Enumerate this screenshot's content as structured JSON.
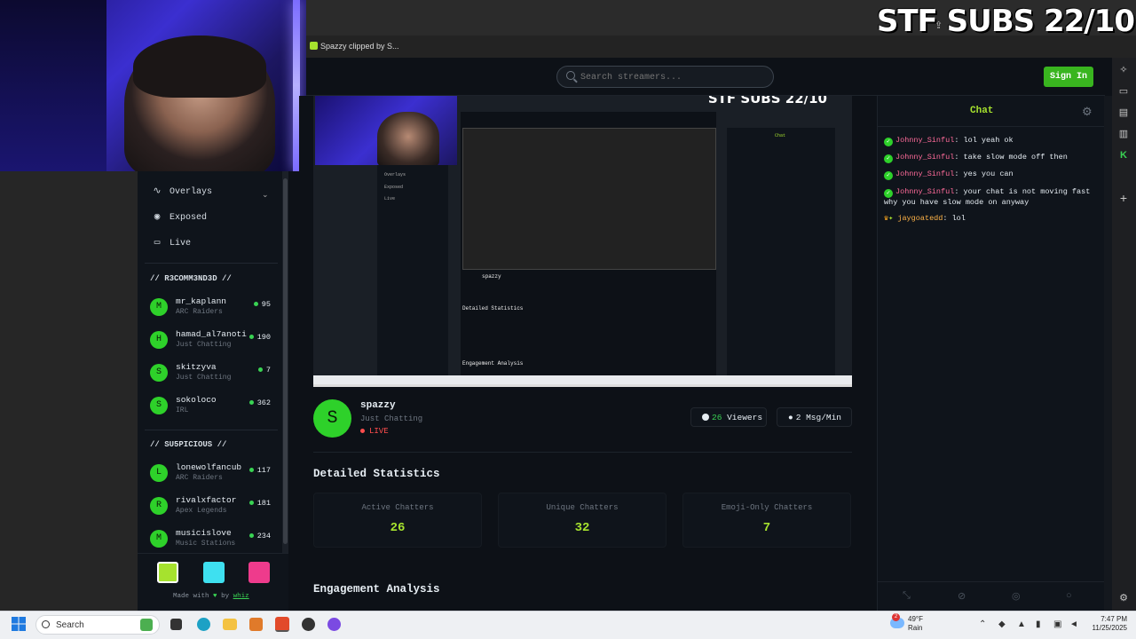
{
  "overlay": {
    "title": "STF SUBS 22/10"
  },
  "browser": {
    "tab_title": "Spazzy clipped by S...",
    "icons": [
      "share-icon",
      "sidebar-copilot-icon",
      "sidebar-tv-icon",
      "sidebar-calendar-icon",
      "sidebar-book-icon",
      "sidebar-kick-icon",
      "sidebar-add-icon",
      "sidebar-settings-icon"
    ]
  },
  "header": {
    "search_placeholder": "Search streamers...",
    "signin_label": "Sign In"
  },
  "sidebar": {
    "nav": [
      {
        "label": "Overlays",
        "icon": "activity-icon"
      },
      {
        "label": "Exposed",
        "icon": "eye-icon"
      },
      {
        "label": "Live",
        "icon": "tv-icon"
      }
    ],
    "sections": [
      {
        "title": "// R3COMM3ND3D //",
        "streamers": [
          {
            "initial": "M",
            "name": "mr_kaplann",
            "category": "ARC Raiders",
            "viewers": "95"
          },
          {
            "initial": "H",
            "name": "hamad_al7anoti",
            "category": "Just Chatting",
            "viewers": "190"
          },
          {
            "initial": "S",
            "name": "skitzyva",
            "category": "Just Chatting",
            "viewers": "7"
          },
          {
            "initial": "S",
            "name": "sokoloco",
            "category": "IRL",
            "viewers": "362"
          }
        ]
      },
      {
        "title": "// SU5PICIOUS //",
        "streamers": [
          {
            "initial": "L",
            "name": "lonewolfancub",
            "category": "ARC Raiders",
            "viewers": "117"
          },
          {
            "initial": "R",
            "name": "rivalxfactor",
            "category": "Apex Legends",
            "viewers": "181"
          },
          {
            "initial": "M",
            "name": "musicislove",
            "category": "Music Stations",
            "viewers": "234"
          }
        ]
      }
    ],
    "swatches": [
      "#a6e22e",
      "#3ee0f0",
      "#ee3b8c"
    ],
    "made_with": "Made with",
    "by": "by",
    "author": "whiz"
  },
  "stream": {
    "initial": "S",
    "name": "spazzy",
    "category": "Just Chatting",
    "status": "LIVE",
    "viewers": "26",
    "viewers_label": "Viewers",
    "msg_rate": "2 Msg/Min"
  },
  "stats": {
    "title": "Detailed Statistics",
    "items": [
      {
        "label": "Active Chatters",
        "value": "26"
      },
      {
        "label": "Unique Chatters",
        "value": "32"
      },
      {
        "label": "Emoji-Only Chatters",
        "value": "7"
      }
    ]
  },
  "engagement": {
    "title": "Engagement Analysis"
  },
  "chat": {
    "title": "Chat",
    "messages": [
      {
        "user": "Johnny_Sinful",
        "text": "lol yeah ok"
      },
      {
        "user": "Johnny_Sinful",
        "text": "take slow mode off then"
      },
      {
        "user": "Johnny_Sinful",
        "text": "yes you can"
      },
      {
        "user": "Johnny_Sinful",
        "text": "your chat is not moving fast why you have slow mode on anyway"
      },
      {
        "user": "jaygoatedd",
        "text": "lol"
      }
    ]
  },
  "taskbar": {
    "search_label": "Search",
    "weather_temp": "49°F",
    "weather_desc": "Rain",
    "weather_alert": "2",
    "time": "7:47 PM",
    "date": "11/25/2025"
  },
  "colors": {
    "accent": "#a6e22e",
    "live": "#ff4d4d",
    "avatar": "#2ed12a",
    "signin": "#39b51f"
  }
}
